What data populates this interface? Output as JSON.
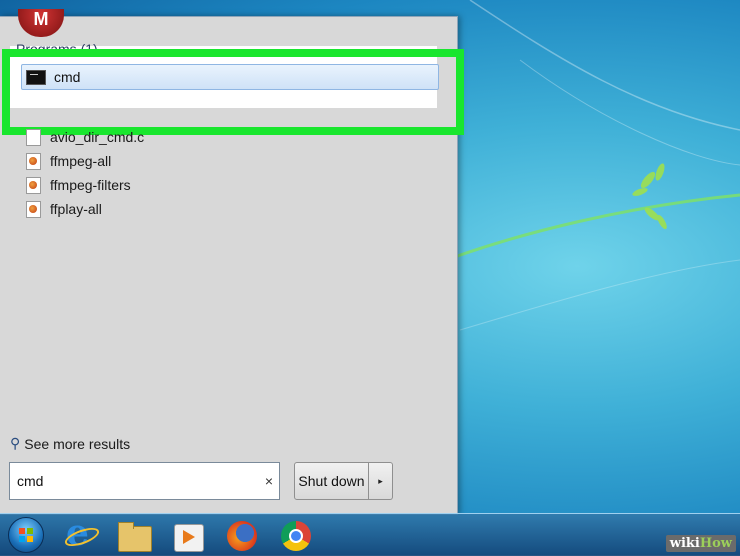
{
  "start_menu": {
    "programs_header": "Programs (1)",
    "top_result": {
      "label": "cmd",
      "icon": "command-prompt-icon"
    },
    "files": [
      {
        "label": "avio_dir_cmd.c",
        "icon": "document-icon"
      },
      {
        "label": "ffmpeg-all",
        "icon": "media-file-icon"
      },
      {
        "label": "ffmpeg-filters",
        "icon": "media-file-icon"
      },
      {
        "label": "ffplay-all",
        "icon": "media-file-icon"
      }
    ],
    "see_more": "See more results",
    "search": {
      "value": "cmd",
      "clear": "×"
    },
    "shutdown": {
      "label": "Shut down",
      "arrow": "▸"
    }
  },
  "watermark": {
    "wiki": "wiki",
    "how": "How"
  },
  "colors": {
    "highlight": "#19e62e",
    "selection": "#cfe2f7",
    "taskbar": "#1c5a8f"
  }
}
